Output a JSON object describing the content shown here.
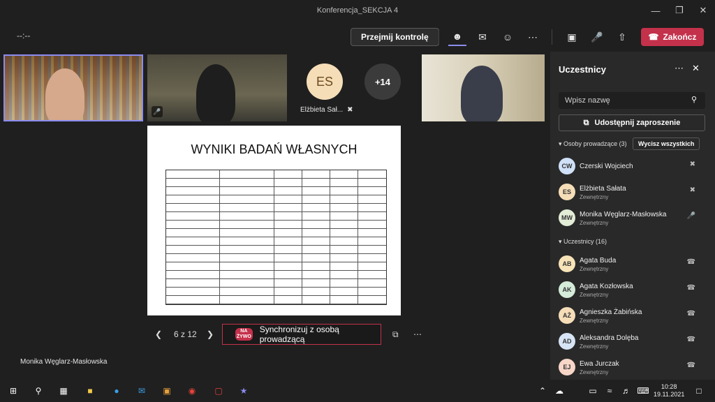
{
  "window": {
    "title": "Konferencja_SEKCJA 4"
  },
  "toolbar": {
    "timer": "--:--",
    "take_control": "Przejmij kontrolę",
    "end_call": "Zakończ"
  },
  "stage": {
    "tiles": [
      {
        "initials": "ES",
        "name": "Elżbieta Sał..."
      },
      {
        "label": "+14"
      }
    ],
    "slide_title": "WYNIKI BADAŃ WŁASNYCH",
    "pager": {
      "text": "6 z 12"
    },
    "sync": {
      "live_badge": "NA ŻYWO",
      "label": "Synchronizuj z osobą prowadzącą"
    },
    "presenter_name": "Monika Węglarz-Masłowska"
  },
  "panel": {
    "title": "Uczestnicy",
    "search_placeholder": "Wpisz nazwę",
    "invite_label": "Udostępnij zaproszenie",
    "presenters_header": "Osoby prowadzące (3)",
    "mute_all": "Wycisz wszystkich",
    "presenters": [
      {
        "initials": "CW",
        "name": "Czerski Wojciech",
        "sub": "",
        "color": "#cfe0f7"
      },
      {
        "initials": "ES",
        "name": "Elżbieta Sałata",
        "sub": "Zewnętrzny",
        "color": "#f5ddb8"
      },
      {
        "initials": "MW",
        "name": "Monika Węglarz-Masłowska",
        "sub": "Zewnętrzny",
        "color": "#e2ecd6"
      }
    ],
    "attendees_header": "Uczestnicy (16)",
    "attendees": [
      {
        "initials": "AB",
        "name": "Agata Buda",
        "sub": "Zewnętrzny",
        "color": "#f7e3b8"
      },
      {
        "initials": "AK",
        "name": "Agata Kozłowska",
        "sub": "Zewnętrzny",
        "color": "#d4ecd9"
      },
      {
        "initials": "AŻ",
        "name": "Agnieszka Żabińska",
        "sub": "Zewnętrzny",
        "color": "#f5ddb8"
      },
      {
        "initials": "AD",
        "name": "Aleksandra Dolęba",
        "sub": "Zewnętrzny",
        "color": "#d6e4f5"
      },
      {
        "initials": "EJ",
        "name": "Ewa Jurczak",
        "sub": "Zewnętrzny",
        "color": "#f7d6c8"
      }
    ]
  },
  "taskbar": {
    "time": "10:28",
    "date": "19.11.2021"
  },
  "colors": {
    "accent": "#8b8cf0",
    "end_red": "#c4314b",
    "panel_bg": "#292929"
  }
}
